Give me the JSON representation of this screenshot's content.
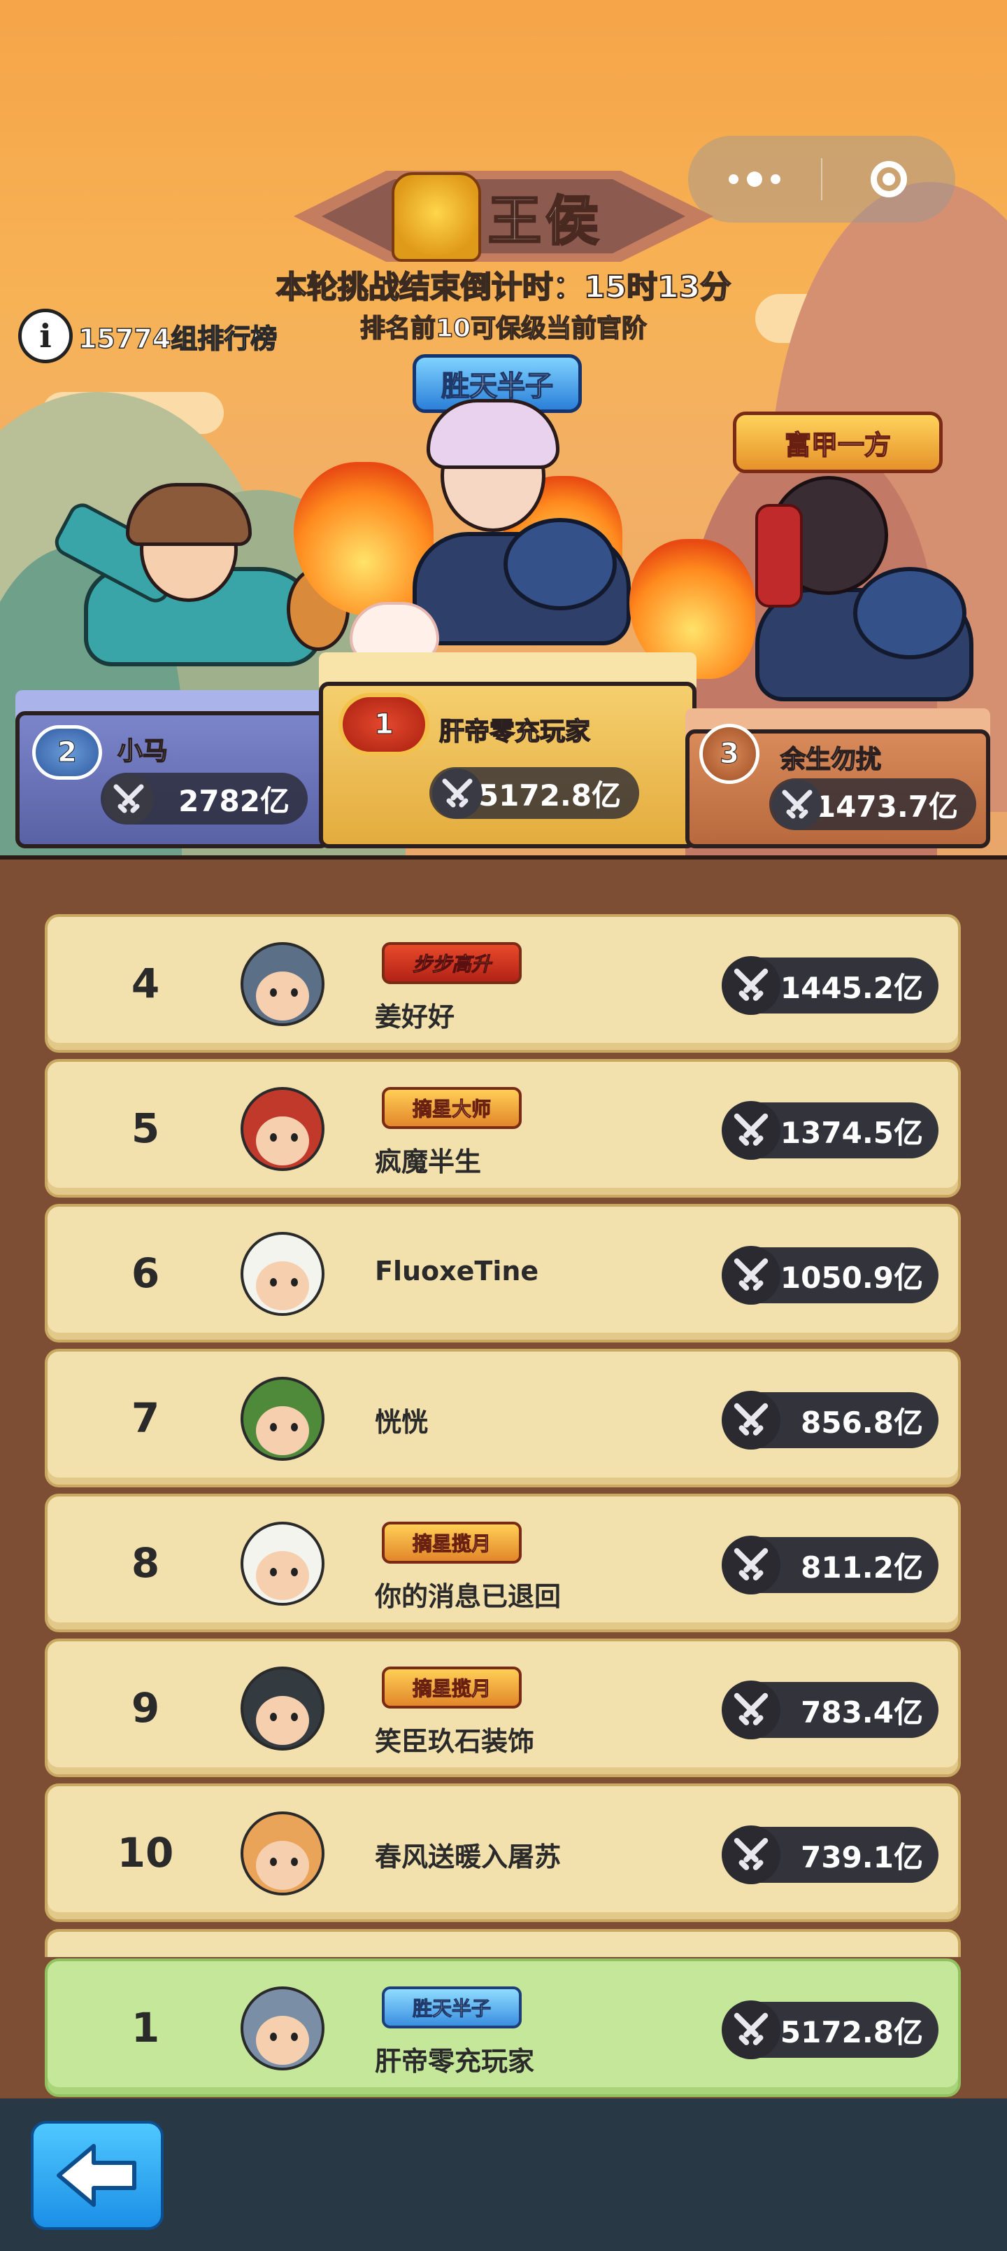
{
  "header": {
    "title": "王侯",
    "countdown": "本轮挑战结束倒计时：15时13分",
    "subnote": "排名前10可保级当前官阶",
    "group_rank_label": "15774组排行榜",
    "capsule": {
      "more_icon": "more-dots-icon",
      "close_icon": "target-circle-icon"
    }
  },
  "podium": [
    {
      "rank": "1",
      "name": "肝帝零充玩家",
      "power": "5172.8亿",
      "title": "胜天半子"
    },
    {
      "rank": "2",
      "name": "小马",
      "power": "2782亿"
    },
    {
      "rank": "3",
      "name": "余生勿扰",
      "power": "1473.7亿",
      "title": "富甲一方"
    }
  ],
  "rows": [
    {
      "rank": "4",
      "name": "姜好好",
      "badge": "步步高升",
      "power": "1445.2亿"
    },
    {
      "rank": "5",
      "name": "疯魔半生",
      "badge": "摘星大师",
      "power": "1374.5亿"
    },
    {
      "rank": "6",
      "name": "FluoxeTine",
      "badge": "",
      "power": "1050.9亿"
    },
    {
      "rank": "7",
      "name": "恍恍",
      "badge": "",
      "power": "856.8亿"
    },
    {
      "rank": "8",
      "name": "你的消息已退回",
      "badge": "摘星揽月",
      "power": "811.2亿"
    },
    {
      "rank": "9",
      "name": "笑臣玖石装饰",
      "badge": "摘星揽月",
      "power": "783.4亿"
    },
    {
      "rank": "10",
      "name": "春风送暖入屠苏",
      "badge": "",
      "power": "739.1亿"
    }
  ],
  "my_rank": {
    "rank": "1",
    "name": "肝帝零充玩家",
    "badge": "胜天半子",
    "power": "5172.8亿"
  },
  "colors": {
    "panel": "#7d4e34",
    "row": "#f2e0ad",
    "my_row": "#c4e79a",
    "bottom_bar": "#283844",
    "back_button": "#2aa8f2"
  },
  "icons": {
    "sword": "crossed-swords-icon",
    "back": "back-arrow-icon",
    "info": "info-icon"
  }
}
